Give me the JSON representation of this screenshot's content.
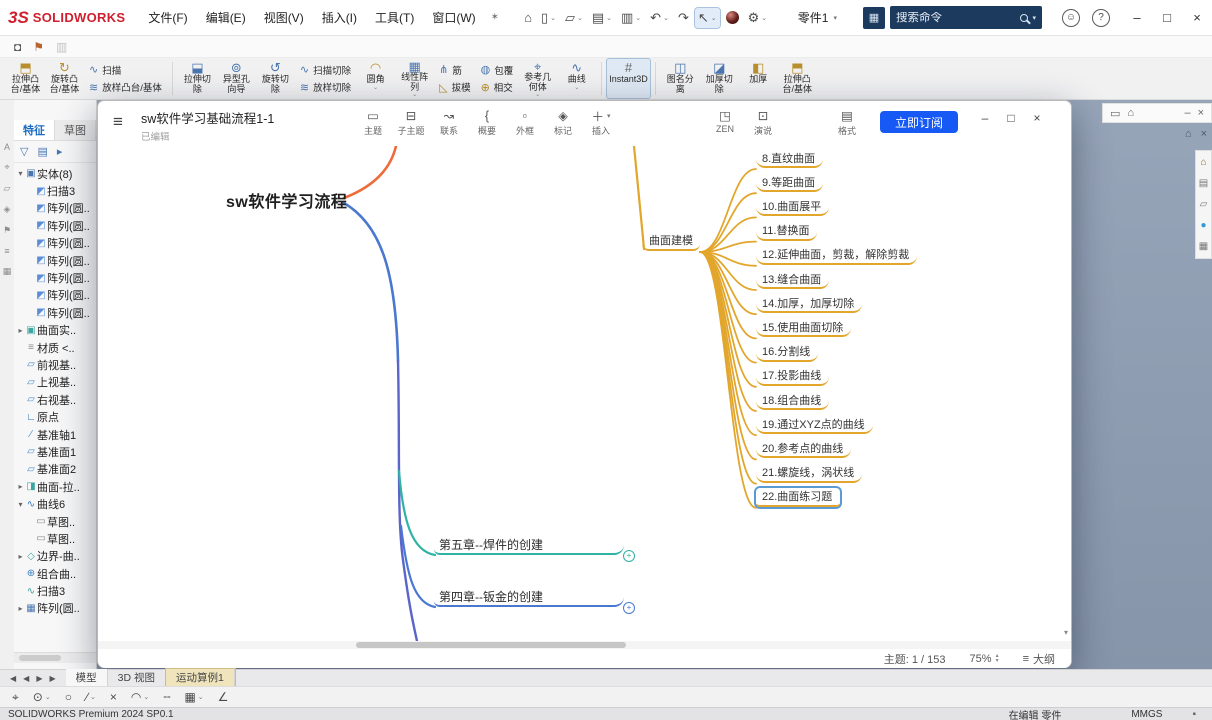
{
  "titlebar": {
    "logo_mark": "3S",
    "logo_text": "SOLIDWORKS",
    "menus": [
      "文件(F)",
      "编辑(E)",
      "视图(V)",
      "插入(I)",
      "工具(T)",
      "窗口(W)"
    ],
    "pin_icon": "✶",
    "quick_tools": [
      {
        "name": "home-icon",
        "glyph": "⌂"
      },
      {
        "name": "new-document-icon",
        "glyph": "▯",
        "caret": true
      },
      {
        "name": "open-icon",
        "glyph": "▱",
        "caret": true
      },
      {
        "name": "save-icon",
        "glyph": "▤",
        "caret": true
      },
      {
        "name": "print-icon",
        "glyph": "▥",
        "caret": true
      },
      {
        "name": "undo-icon",
        "glyph": "↶",
        "caret": true
      },
      {
        "name": "redo-icon",
        "glyph": "↷"
      },
      {
        "name": "select-cursor-icon",
        "glyph": "↖",
        "caret": true,
        "active": true
      },
      {
        "name": "material-sphere-icon",
        "glyph": "",
        "sphere": true
      },
      {
        "name": "settings-gear-icon",
        "glyph": "⚙",
        "caret": true
      }
    ],
    "doc_title": "零件1",
    "doc_caret": "▾",
    "apps_glyph": "▦",
    "search_placeholder": "搜索命令",
    "search_caret": "▾",
    "account_glyph": "☺",
    "help_glyph": "?",
    "win_min": "–",
    "win_max": "□",
    "win_close": "×"
  },
  "quickbar": [
    {
      "name": "screenshot-camera-icon",
      "glyph": "◘"
    },
    {
      "name": "flag-icon",
      "glyph": "⚑",
      "color": "#b8642f"
    },
    {
      "name": "display-pane-icon",
      "glyph": "▥",
      "disabled": true
    }
  ],
  "ribbon": [
    {
      "type": "large",
      "name": "extruded-boss-button",
      "lines": [
        "拉伸凸",
        "台/基体"
      ],
      "glyph": "⬒",
      "color": "#b98f2e"
    },
    {
      "type": "large",
      "name": "revolved-boss-button",
      "lines": [
        "旋转凸",
        "台/基体"
      ],
      "glyph": "↻",
      "color": "#b98f2e"
    },
    {
      "type": "stack",
      "items": [
        {
          "name": "swept-boss-button",
          "label": "扫描",
          "glyph": "∿",
          "color": "#4a76b0"
        },
        {
          "name": "lofted-boss-button",
          "label": "放样凸台/基体",
          "glyph": "≋",
          "color": "#4a76b0"
        }
      ]
    },
    {
      "type": "sep"
    },
    {
      "type": "large",
      "name": "extruded-cut-button",
      "lines": [
        "拉伸切",
        "除"
      ],
      "glyph": "⬓",
      "color": "#4a76b0"
    },
    {
      "type": "large",
      "name": "hole-wizard-button",
      "lines": [
        "异型孔",
        "向导"
      ],
      "glyph": "⊚",
      "color": "#4a76b0"
    },
    {
      "type": "large",
      "name": "revolved-cut-button",
      "lines": [
        "旋转切",
        "除"
      ],
      "glyph": "↺",
      "color": "#4a76b0"
    },
    {
      "type": "stack",
      "items": [
        {
          "name": "swept-cut-button",
          "label": "扫描切除",
          "glyph": "∿",
          "color": "#4a76b0"
        },
        {
          "name": "lofted-cut-button",
          "label": "放样切除",
          "glyph": "≋",
          "color": "#4a76b0"
        }
      ]
    },
    {
      "type": "large",
      "name": "fillet-button",
      "lines": [
        "圆角",
        ""
      ],
      "glyph": "◠",
      "color": "#b98f2e",
      "caret": true
    },
    {
      "type": "large",
      "name": "linear-pattern-button",
      "lines": [
        "线性阵",
        "列"
      ],
      "glyph": "▦",
      "color": "#4a76b0",
      "caret": true
    },
    {
      "type": "stack",
      "items": [
        {
          "name": "rib-button",
          "label": "筋",
          "glyph": "⋔",
          "color": "#4a76b0"
        },
        {
          "name": "draft-button",
          "label": "拔模",
          "glyph": "◺",
          "color": "#b98f2e"
        }
      ]
    },
    {
      "type": "stack",
      "items": [
        {
          "name": "wrap-button",
          "label": "包覆",
          "glyph": "◍",
          "color": "#4a76b0"
        },
        {
          "name": "intersect-button",
          "label": "相交",
          "glyph": "⊕",
          "color": "#b98f2e"
        }
      ]
    },
    {
      "type": "large",
      "name": "reference-geometry-button",
      "lines": [
        "参考几",
        "何体"
      ],
      "glyph": "⌖",
      "color": "#4a76b0",
      "caret": true
    },
    {
      "type": "large",
      "name": "curves-button",
      "lines": [
        "曲线",
        ""
      ],
      "glyph": "∿",
      "color": "#4a76b0",
      "caret": true
    },
    {
      "type": "sep"
    },
    {
      "type": "large",
      "name": "instant3d-button",
      "lines": [
        "Instant3D",
        ""
      ],
      "glyph": "#",
      "color": "#666666",
      "active": true
    },
    {
      "type": "sep"
    },
    {
      "type": "large",
      "name": "detach-button",
      "lines": [
        "图名分",
        "离"
      ],
      "glyph": "◫",
      "color": "#4a76b0"
    },
    {
      "type": "large",
      "name": "thicken-cut-button",
      "lines": [
        "加厚切",
        "除"
      ],
      "glyph": "◪",
      "color": "#4a76b0"
    },
    {
      "type": "large",
      "name": "thicken-button",
      "lines": [
        "加厚",
        ""
      ],
      "glyph": "◧",
      "color": "#b98f2e"
    },
    {
      "type": "large",
      "name": "extruded-boss-2-button",
      "lines": [
        "拉伸凸",
        "台/基体"
      ],
      "glyph": "⬒",
      "color": "#b98f2e"
    }
  ],
  "left_strip": [
    {
      "name": "select-filter-icon",
      "glyph": "A"
    },
    {
      "name": "filter-vertex-icon",
      "glyph": "⌖"
    },
    {
      "name": "filter-edge-icon",
      "glyph": "▱"
    },
    {
      "name": "filter-face-icon",
      "glyph": "◈"
    },
    {
      "name": "annotation-flag-icon",
      "glyph": "⚑"
    },
    {
      "name": "dimension-icon",
      "glyph": "≡"
    },
    {
      "name": "grid-icon",
      "glyph": "▦"
    }
  ],
  "feature_panel": {
    "tabs": [
      {
        "label": "特征",
        "active": true
      },
      {
        "label": "草图",
        "active": false
      }
    ],
    "toolbar": [
      {
        "name": "filter-icon",
        "glyph": "▽"
      },
      {
        "name": "tree-display-icon",
        "glyph": "▤"
      },
      {
        "name": "expand-panel-icon",
        "glyph": "▸"
      }
    ],
    "rows": [
      {
        "arrow": "▾",
        "glyph": "▣",
        "color": "#4a76b0",
        "label": "实体(8)",
        "indent": 0
      },
      {
        "glyph": "◩",
        "color": "#5b8ed6",
        "label": "扫描3",
        "indent": 1
      },
      {
        "glyph": "◩",
        "color": "#5b8ed6",
        "label": "阵列(圆..",
        "indent": 1
      },
      {
        "glyph": "◩",
        "color": "#5b8ed6",
        "label": "阵列(圆..",
        "indent": 1
      },
      {
        "glyph": "◩",
        "color": "#5b8ed6",
        "label": "阵列(圆..",
        "indent": 1
      },
      {
        "glyph": "◩",
        "color": "#5b8ed6",
        "label": "阵列(圆..",
        "indent": 1
      },
      {
        "glyph": "◩",
        "color": "#5b8ed6",
        "label": "阵列(圆..",
        "indent": 1
      },
      {
        "glyph": "◩",
        "color": "#5b8ed6",
        "label": "阵列(圆..",
        "indent": 1
      },
      {
        "glyph": "◩",
        "color": "#5b8ed6",
        "label": "阵列(圆..",
        "indent": 1
      },
      {
        "arrow": "▸",
        "glyph": "▣",
        "color": "#3ea5a0",
        "label": "曲面实..",
        "indent": 0
      },
      {
        "glyph": "≡",
        "color": "#8a8a8a",
        "label": "材质 <..",
        "indent": 0
      },
      {
        "glyph": "▱",
        "color": "#4a8fd0",
        "label": "前视基..",
        "indent": 0
      },
      {
        "glyph": "▱",
        "color": "#4a8fd0",
        "label": "上视基..",
        "indent": 0
      },
      {
        "glyph": "▱",
        "color": "#4a8fd0",
        "label": "右视基..",
        "indent": 0
      },
      {
        "glyph": "∟",
        "color": "#2a6fb8",
        "label": "原点",
        "indent": 0
      },
      {
        "glyph": "∕",
        "color": "#4a8fd0",
        "label": "基准轴1",
        "indent": 0
      },
      {
        "glyph": "▱",
        "color": "#4a8fd0",
        "label": "基准面1",
        "indent": 0
      },
      {
        "glyph": "▱",
        "color": "#4a8fd0",
        "label": "基准面2",
        "indent": 0
      },
      {
        "arrow": "▸",
        "glyph": "◨",
        "color": "#3ea5a0",
        "label": "曲面-拉..",
        "indent": 0
      },
      {
        "arrow": "▾",
        "glyph": "∿",
        "color": "#3a7fc0",
        "label": "曲线6",
        "indent": 0
      },
      {
        "glyph": "▭",
        "color": "#888888",
        "label": "草图..",
        "indent": 1
      },
      {
        "glyph": "▭",
        "color": "#888888",
        "label": "草图..",
        "indent": 1
      },
      {
        "arrow": "▸",
        "glyph": "◇",
        "color": "#3ea5a0",
        "label": "边界-曲..",
        "indent": 0
      },
      {
        "glyph": "⊕",
        "color": "#3a7fc0",
        "label": "组合曲..",
        "indent": 0
      },
      {
        "glyph": "∿",
        "color": "#3ea5a0",
        "label": "扫描3",
        "indent": 0
      },
      {
        "arrow": "▸",
        "glyph": "▦",
        "color": "#4a76b0",
        "label": "阵列(圆..",
        "indent": 0
      }
    ]
  },
  "viewport": {
    "corner_icons": [
      {
        "name": "window-restore-icon",
        "glyph": "▭"
      },
      {
        "name": "viewport-home-icon",
        "glyph": "⌂"
      }
    ],
    "corner_right": [
      {
        "name": "pane-minimize-icon",
        "glyph": "–"
      },
      {
        "name": "pane-close-icon",
        "glyph": "×"
      }
    ],
    "row2_icons": [
      {
        "name": "doc-home-icon",
        "glyph": "⌂"
      },
      {
        "name": "doc-close-icon",
        "glyph": "×"
      }
    ],
    "task_pane": [
      {
        "name": "resources-home-icon",
        "glyph": "⌂",
        "color": "#8a6a2f"
      },
      {
        "name": "design-library-icon",
        "glyph": "▤",
        "color": "#777777"
      },
      {
        "name": "file-explorer-icon",
        "glyph": "▱",
        "color": "#777777"
      },
      {
        "name": "appearances-globe-icon",
        "glyph": "●",
        "color": "#2e9bd6"
      },
      {
        "name": "custom-properties-icon",
        "glyph": "▦",
        "color": "#777777"
      }
    ]
  },
  "mindmap": {
    "menu_glyph": "≡",
    "title": "sw软件学习基础流程1-1",
    "subtitle": "已编辑",
    "toolbar_left": [
      {
        "name": "topic-button",
        "label": "主题",
        "glyph": "▭"
      },
      {
        "name": "subtopic-button",
        "label": "子主题",
        "glyph": "⊟"
      },
      {
        "name": "relation-button",
        "label": "联系",
        "glyph": "↝"
      },
      {
        "name": "summary-button",
        "label": "概要",
        "glyph": "{"
      },
      {
        "name": "outer-frame-button",
        "label": "外框",
        "glyph": "▫"
      },
      {
        "name": "marker-button",
        "label": "标记",
        "glyph": "◈"
      },
      {
        "name": "insert-button",
        "label": "插入",
        "glyph": "＋",
        "caret": "▾"
      }
    ],
    "toolbar_right": [
      {
        "name": "zen-mode-button",
        "label": "ZEN",
        "glyph": "◳"
      },
      {
        "name": "presentation-button",
        "label": "演说",
        "glyph": "⊡"
      },
      {
        "name": "format-button",
        "label": "格式",
        "glyph": "▤",
        "gap": true
      }
    ],
    "subscribe_label": "立即订阅",
    "win_min": "–",
    "win_max": "□",
    "win_close": "×",
    "central_topic": "sw软件学习流程",
    "branch_node": "曲面建模",
    "leaves": [
      "8.直纹曲面",
      "9.等距曲面",
      "10.曲面展平",
      "11.替换面",
      "12.延伸曲面，剪裁，解除剪裁",
      "13.缝合曲面",
      "14.加厚，加厚切除",
      "15.使用曲面切除",
      "16.分割线",
      "17.投影曲线",
      "18.组合曲线",
      "19.通过XYZ点的曲线",
      "20.参考点的曲线",
      "21.螺旋线，涡状线",
      "22.曲面练习题"
    ],
    "selected_leaf": 14,
    "chapters": [
      {
        "label": "第五章--焊件的创建",
        "color": "#2fb3a4",
        "badge": "+"
      },
      {
        "label": "第四章--钣金的创建",
        "color": "#4a78d0",
        "badge": "+"
      }
    ],
    "colors": {
      "yellow": "#e2a62c",
      "teal": "#2fb3a4",
      "blue": "#4a78d0",
      "purple": "#5b64c8",
      "orange": "#ef6c3a"
    },
    "status": {
      "counter": "主题: 1 / 153",
      "zoom": "75%",
      "outline": "大纲",
      "outline_icon": "≡",
      "spin_up": "▴",
      "spin_down": "▾"
    }
  },
  "bottom_tabs": {
    "arrows": [
      "◀",
      "◀",
      "▶",
      "▶"
    ],
    "tabs": [
      {
        "label": "模型",
        "active": true
      },
      {
        "label": "3D 视图"
      },
      {
        "label": "运动算例1",
        "highlight": true
      }
    ]
  },
  "sketchbar": [
    {
      "name": "select-icon",
      "glyph": "⌖"
    },
    {
      "name": "circle-center-icon",
      "glyph": "⊙",
      "caret": true
    },
    {
      "name": "circle-icon",
      "glyph": "○"
    },
    {
      "name": "line-icon",
      "glyph": "∕",
      "caret": true
    },
    {
      "name": "close-sketch-icon",
      "glyph": "×"
    },
    {
      "name": "arc-icon",
      "glyph": "◠",
      "caret": true
    },
    {
      "name": "dashed-line-icon",
      "glyph": "╌"
    },
    {
      "name": "grid-icon",
      "glyph": "▦",
      "caret": true
    },
    {
      "name": "angle-icon",
      "glyph": "∠"
    }
  ],
  "statusbar": {
    "left": "SOLIDWORKS Premium 2024 SP0.1",
    "editing": "在编辑 零件",
    "units": "MMGS",
    "dot": "▪"
  }
}
